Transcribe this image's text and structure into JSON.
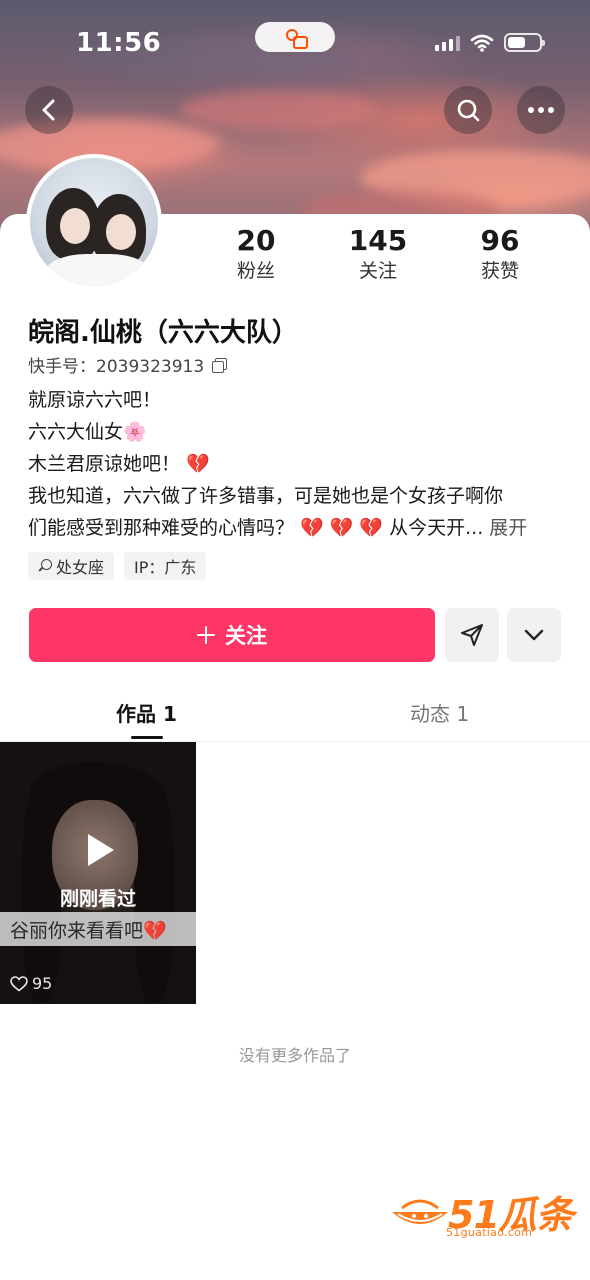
{
  "status_bar": {
    "time": "11:56",
    "app_pill_label": "快手"
  },
  "nav": {
    "back_icon": "chevron-left-icon",
    "search_icon": "search-icon",
    "more_icon": "more-horizontal-icon"
  },
  "profile": {
    "stats": [
      {
        "num": "20",
        "label": "粉丝"
      },
      {
        "num": "145",
        "label": "关注"
      },
      {
        "num": "96",
        "label": "获赞"
      }
    ],
    "name": "皖阁.仙桃（六六大队）",
    "kuaishou_id": "快手号：2039323913",
    "bio": [
      "就原谅六六吧！",
      "六六大仙女🌸",
      "木兰君原谅她吧！ 💔",
      "我也知道，六六做了许多错事，可是她也是个女孩子啊你",
      "们能感受到那种难受的心情吗？ 💔 💔 💔 从今天开..."
    ],
    "bio_more": "展开",
    "tags": [
      "处女座",
      "IP：广东"
    ]
  },
  "actions": {
    "follow_label": "关注",
    "share_icon": "send-icon",
    "dropdown_icon": "chevron-down-icon"
  },
  "tabs": {
    "works": "作品 1",
    "moments": "动态 1"
  },
  "video": {
    "overlay": "刚刚看过",
    "caption": "谷丽你来看看吧💔",
    "likes": "95"
  },
  "footer": {
    "no_more": "没有更多作品了"
  },
  "watermark": {
    "brand": "51瓜条",
    "url": "51guatiao.com"
  }
}
